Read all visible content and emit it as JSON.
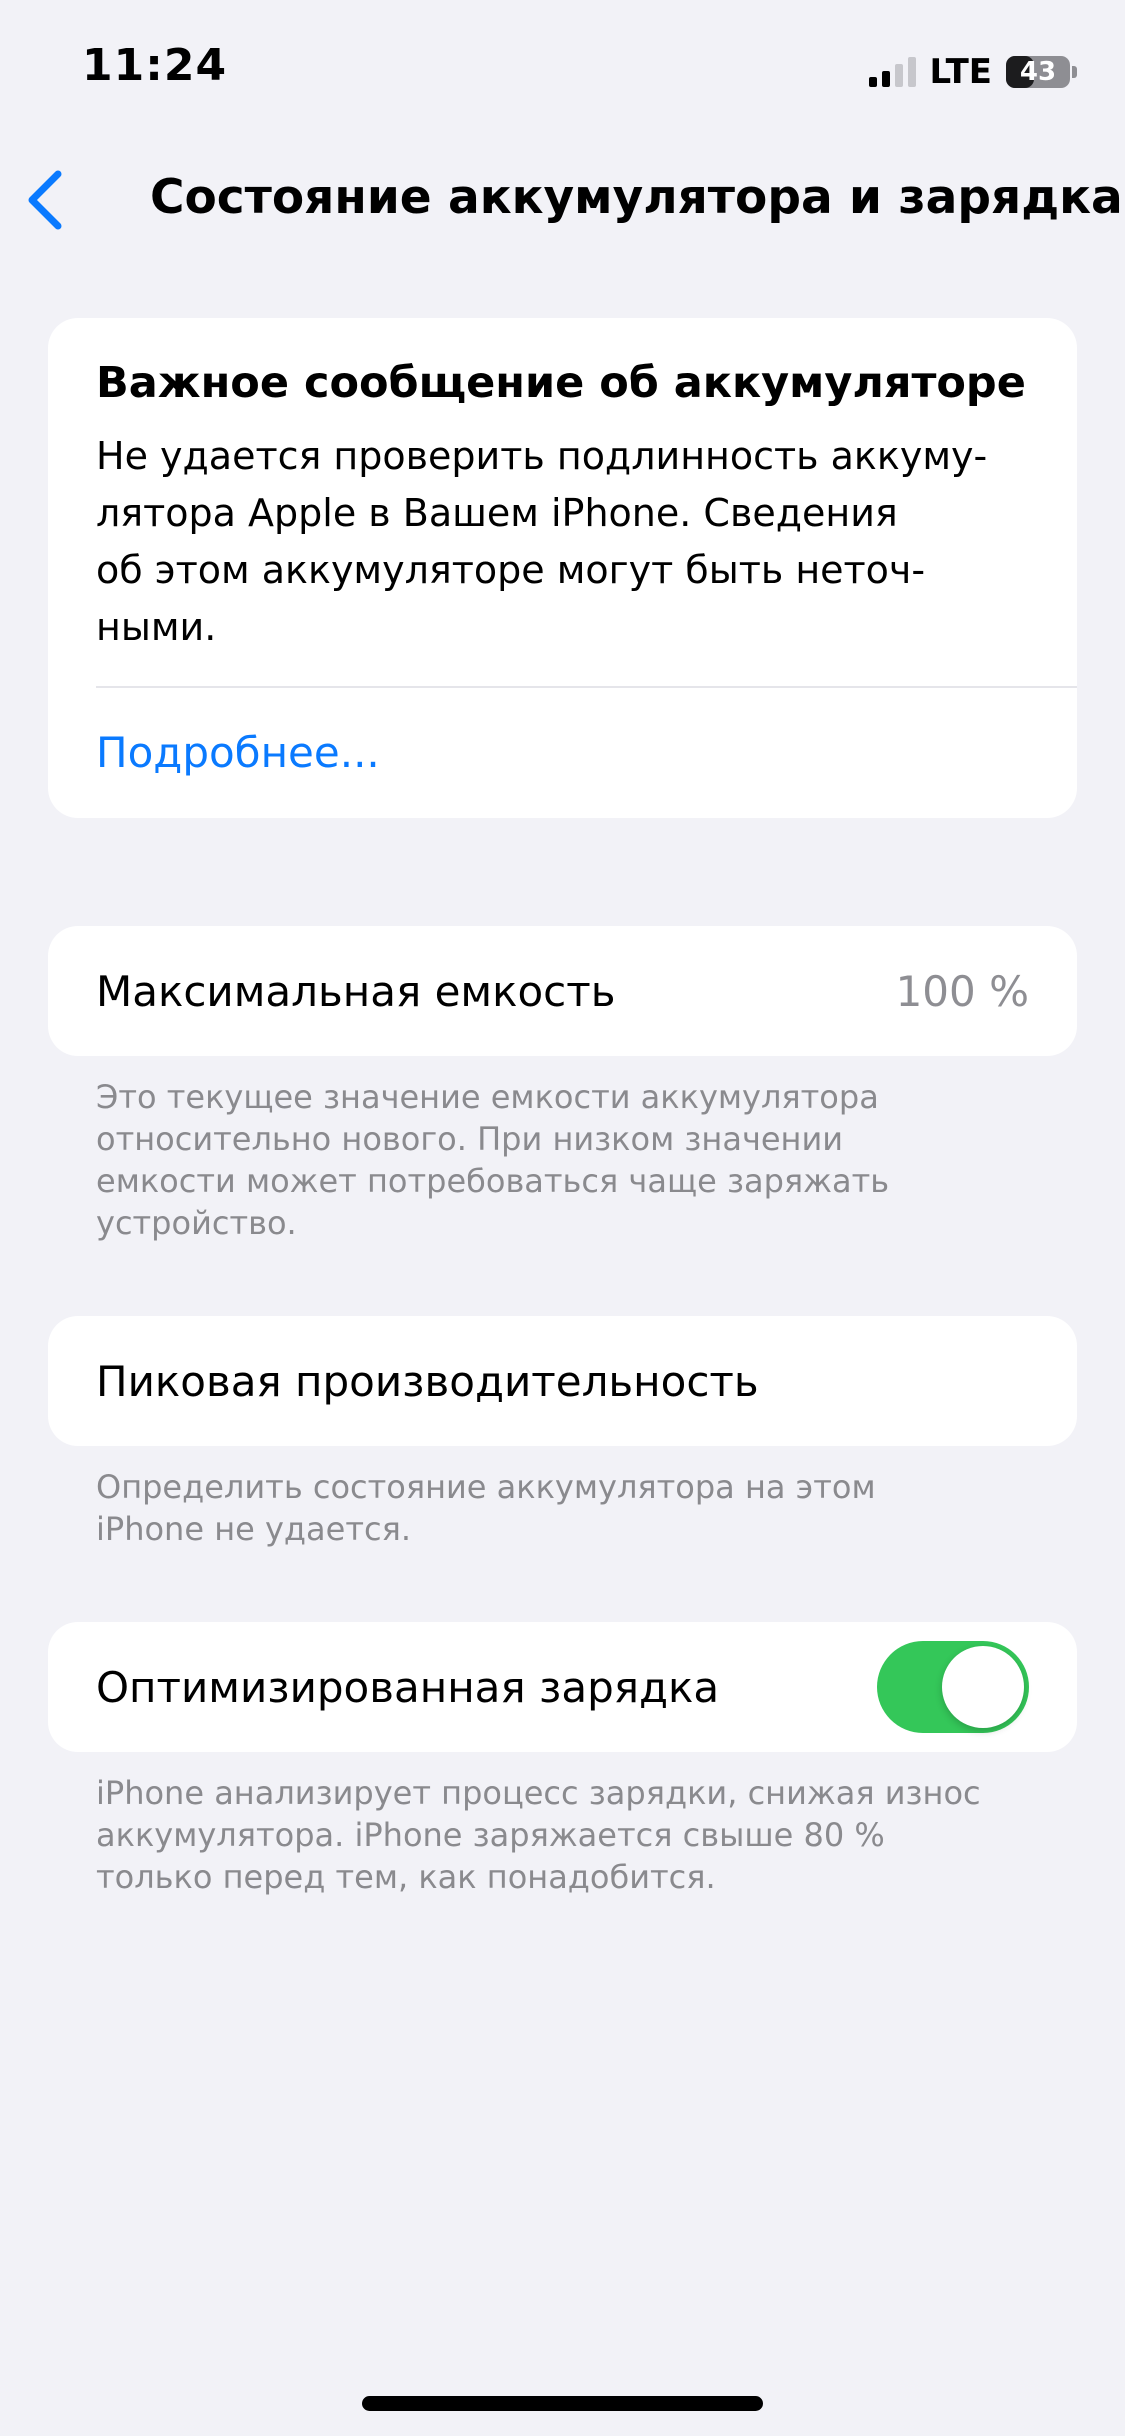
{
  "status_bar": {
    "time": "11:24",
    "network": "LTE",
    "battery_percent": "43",
    "battery_level": 0.43,
    "signal_bars_active": 2,
    "signal_bars_total": 4
  },
  "nav": {
    "back_icon": "chevron-left-icon",
    "title": "Состояние аккумулятора и зарядка"
  },
  "important_message": {
    "title": "Важное сообщение об аккумуляторе",
    "body": "Не удается проверить подлинность аккуму-\nлятора Apple в Вашем iPhone. Сведения\nоб этом аккумуляторе могут быть неточ-\nными.",
    "link": "Подробнее..."
  },
  "max_capacity": {
    "label": "Максимальная емкость",
    "value": "100 %",
    "footnote": "Это текущее значение емкости аккумулятора\nотносительно нового. При низком значении\nемкости может потребоваться чаще заряжать\nустройство."
  },
  "peak_performance": {
    "label": "Пиковая производительность",
    "footnote": "Определить состояние аккумулятора на этом\niPhone не удается."
  },
  "optimized_charging": {
    "label": "Оптимизированная зарядка",
    "enabled": true,
    "footnote": "iPhone анализирует процесс зарядки, снижая износ\nаккумулятора. iPhone заряжается свыше 80 %\nтолько перед тем, как понадобится."
  },
  "colors": {
    "accent": "#0A7AFF",
    "toggle_on": "#34C759",
    "background": "#F2F2F7",
    "secondary_text": "#8A8A8E"
  }
}
